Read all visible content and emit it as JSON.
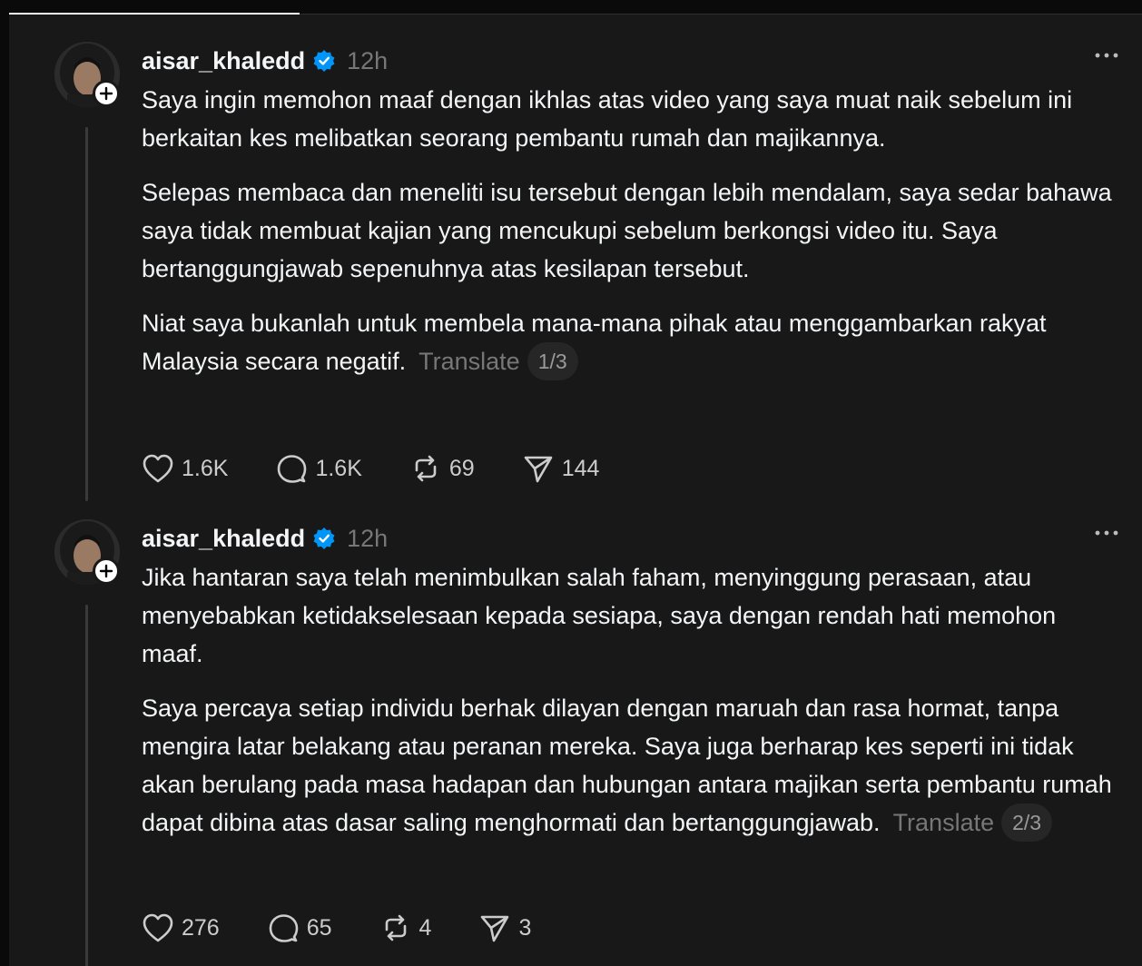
{
  "posts": [
    {
      "username": "aisar_khaledd",
      "time": "12h",
      "paragraphs": [
        "Saya ingin memohon maaf dengan ikhlas atas video yang saya muat naik sebelum ini berkaitan kes melibatkan seorang pembantu rumah dan majikannya.",
        "Selepas membaca dan meneliti isu tersebut dengan lebih mendalam, saya sedar bahawa saya tidak membuat kajian yang mencukupi sebelum berkongsi video itu. Saya bertanggungjawab sepenuhnya atas kesilapan tersebut.",
        "Niat saya bukanlah untuk membela mana-mana pihak atau menggambarkan rakyat Malaysia secara negatif."
      ],
      "translate_label": "Translate",
      "page_indicator": "1/3",
      "likes": "1.6K",
      "replies": "1.6K",
      "reposts": "69",
      "shares": "144"
    },
    {
      "username": "aisar_khaledd",
      "time": "12h",
      "paragraphs": [
        "Jika hantaran saya telah menimbulkan salah faham, menyinggung perasaan, atau menyebabkan ketidakselesaan kepada sesiapa, saya dengan rendah hati memohon maaf.",
        "Saya percaya setiap individu berhak dilayan dengan maruah dan rasa hormat, tanpa mengira latar belakang atau peranan mereka. Saya juga berharap kes seperti ini tidak akan berulang pada masa hadapan dan hubungan antara majikan serta pembantu rumah dapat dibina atas dasar saling menghormati dan bertanggungjawab."
      ],
      "translate_label": "Translate",
      "page_indicator": "2/3",
      "likes": "276",
      "replies": "65",
      "reposts": "4",
      "shares": "3"
    }
  ],
  "colors": {
    "background": "#181818",
    "text": "#f3f5f7",
    "muted": "#777777",
    "verified": "#0095f6"
  }
}
